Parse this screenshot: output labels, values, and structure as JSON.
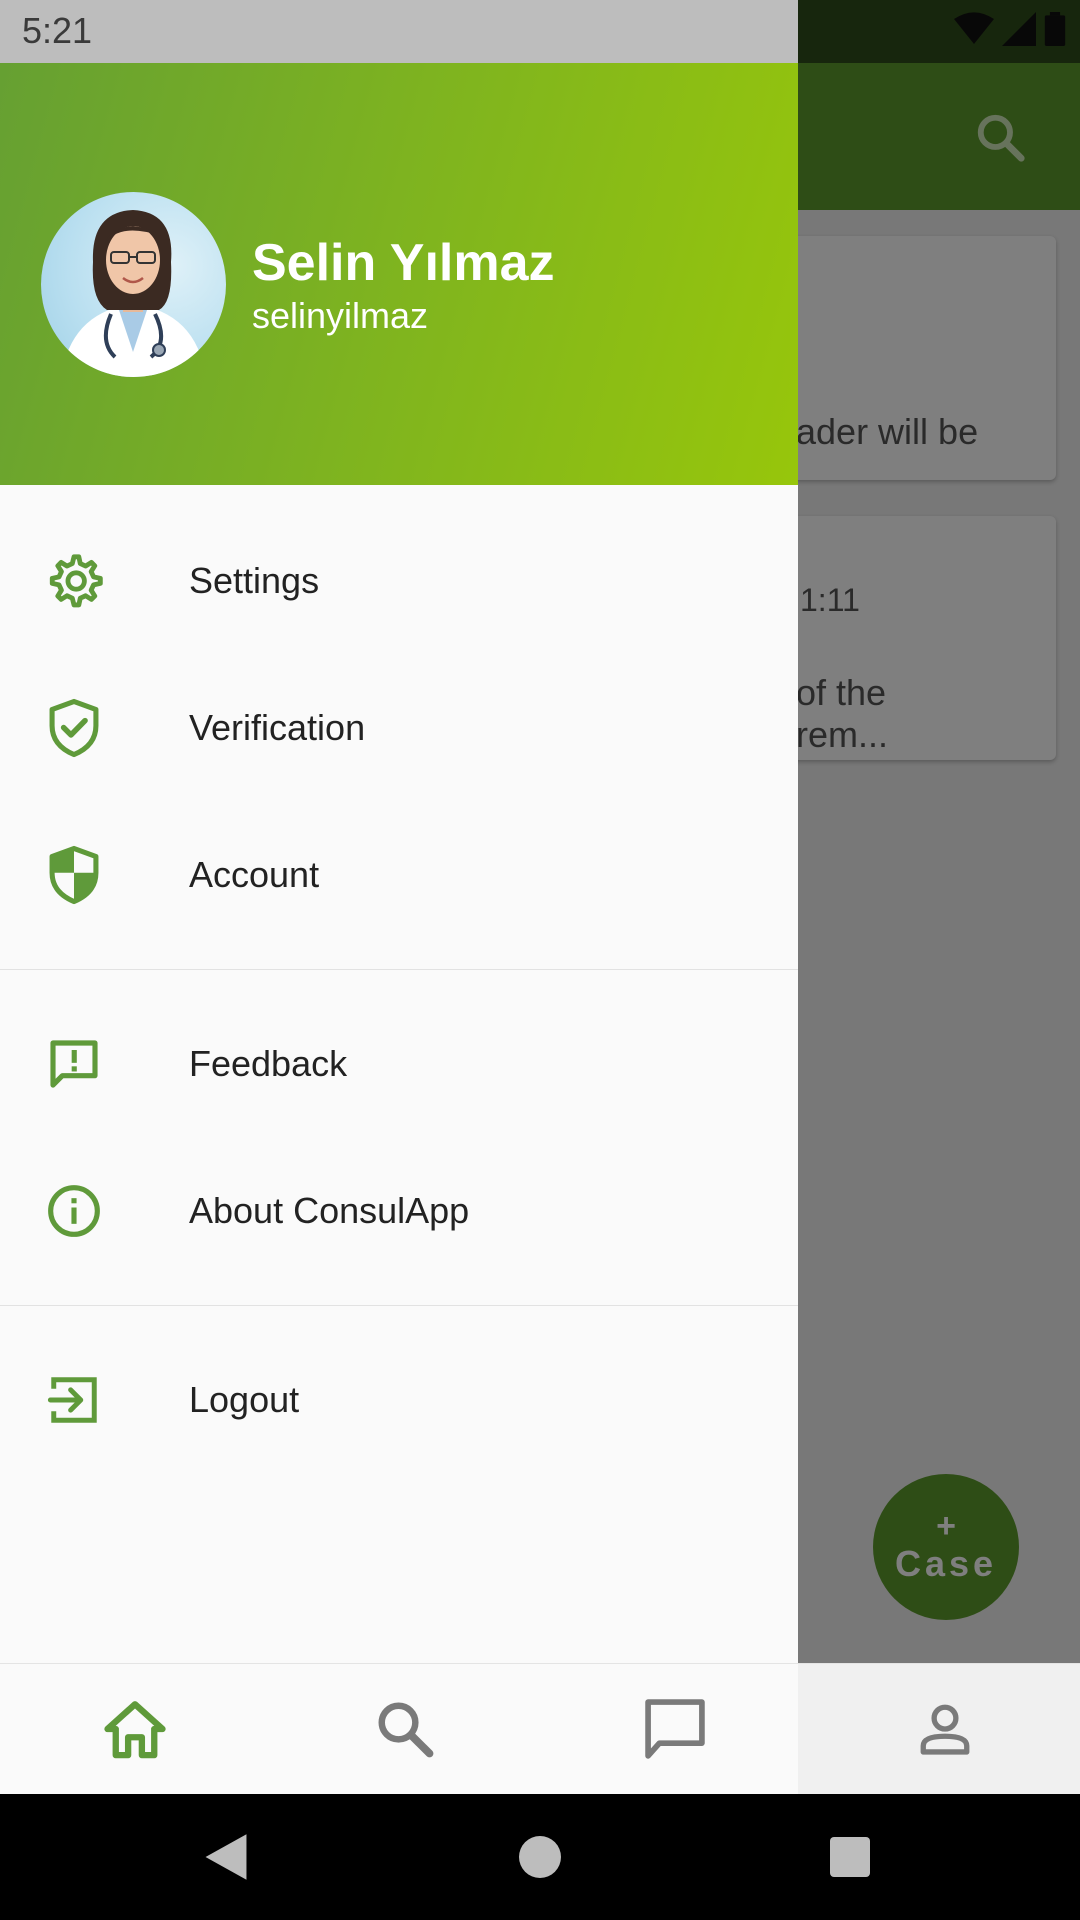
{
  "status_bar": {
    "time": "5:21"
  },
  "background": {
    "card1_snippet": "ader will be",
    "card2_time": "1:11",
    "card2_line1": "of the",
    "card2_line2": "rem...",
    "fab": {
      "plus": "+",
      "label": "Case"
    }
  },
  "drawer": {
    "user": {
      "name": "Selin Yılmaz",
      "handle": "selinyilmaz"
    },
    "menu": [
      {
        "label": "Settings",
        "icon": "gear-icon"
      },
      {
        "label": "Verification",
        "icon": "shield-check-icon"
      },
      {
        "label": "Account",
        "icon": "shield-half-icon"
      },
      {
        "label": "Feedback",
        "icon": "feedback-icon"
      },
      {
        "label": "About ConsulApp",
        "icon": "info-icon"
      },
      {
        "label": "Logout",
        "icon": "logout-icon"
      }
    ]
  },
  "bottom_nav": {
    "items": [
      {
        "icon": "home-icon",
        "active": true
      },
      {
        "icon": "search-icon",
        "active": false
      },
      {
        "icon": "chat-icon",
        "active": false
      },
      {
        "icon": "profile-icon",
        "active": false
      }
    ]
  },
  "colors": {
    "brand_green": "#5c9a2c",
    "icon_green": "#5f9a3a",
    "header_gradient_end": "#97c60b"
  }
}
